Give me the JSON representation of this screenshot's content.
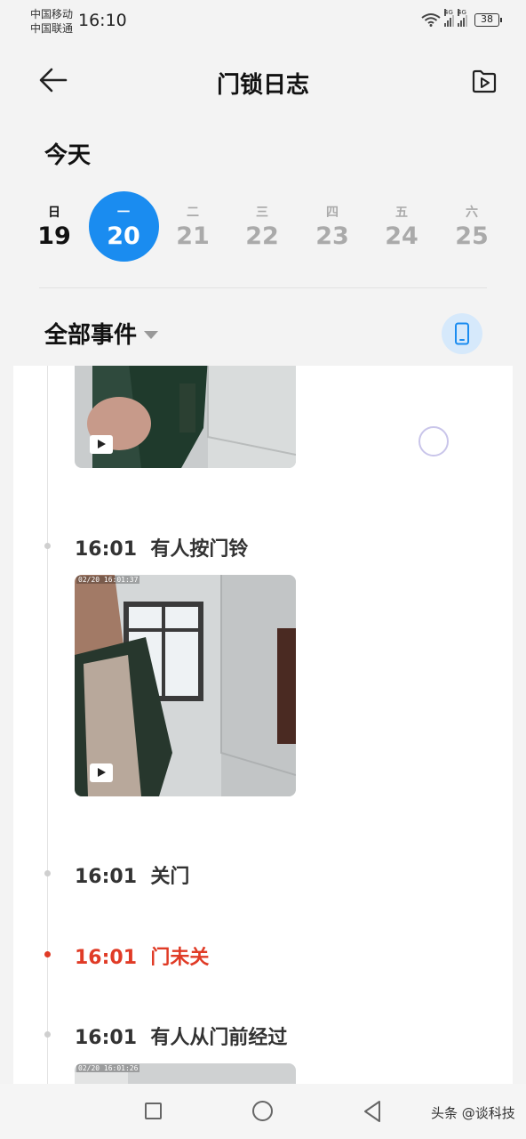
{
  "status_bar": {
    "carrier_1": "中国移动",
    "carrier_2": "中国联通",
    "time": "16:10",
    "net_1": "4G",
    "net_2": "4G",
    "battery": "38"
  },
  "header": {
    "title": "门锁日志",
    "back_icon": "arrow-left-icon",
    "action_icon": "video-folder-icon"
  },
  "date_section": {
    "label": "今天",
    "days": [
      {
        "weekday": "日",
        "date": "19",
        "state": "past"
      },
      {
        "weekday": "一",
        "date": "20",
        "state": "selected"
      },
      {
        "weekday": "二",
        "date": "21",
        "state": "future"
      },
      {
        "weekday": "三",
        "date": "22",
        "state": "future"
      },
      {
        "weekday": "四",
        "date": "23",
        "state": "future"
      },
      {
        "weekday": "五",
        "date": "24",
        "state": "future"
      },
      {
        "weekday": "六",
        "date": "25",
        "state": "future"
      }
    ]
  },
  "filter": {
    "label": "全部事件",
    "device_icon": "phone-icon"
  },
  "events": [
    {
      "time": "16:01",
      "text": "有人按门铃",
      "alert": false,
      "osd": "02/20 16:01:37"
    },
    {
      "time": "16:01",
      "text": "关门",
      "alert": false
    },
    {
      "time": "16:01",
      "text": "门未关",
      "alert": true
    },
    {
      "time": "16:01",
      "text": "有人从门前经过",
      "alert": false,
      "osd": "02/20 16:01:26"
    }
  ],
  "colors": {
    "accent": "#1a8cf0",
    "alert": "#e03b26",
    "background": "#f3f3f3"
  },
  "nav": {
    "watermark": "头条 @谈科技"
  }
}
